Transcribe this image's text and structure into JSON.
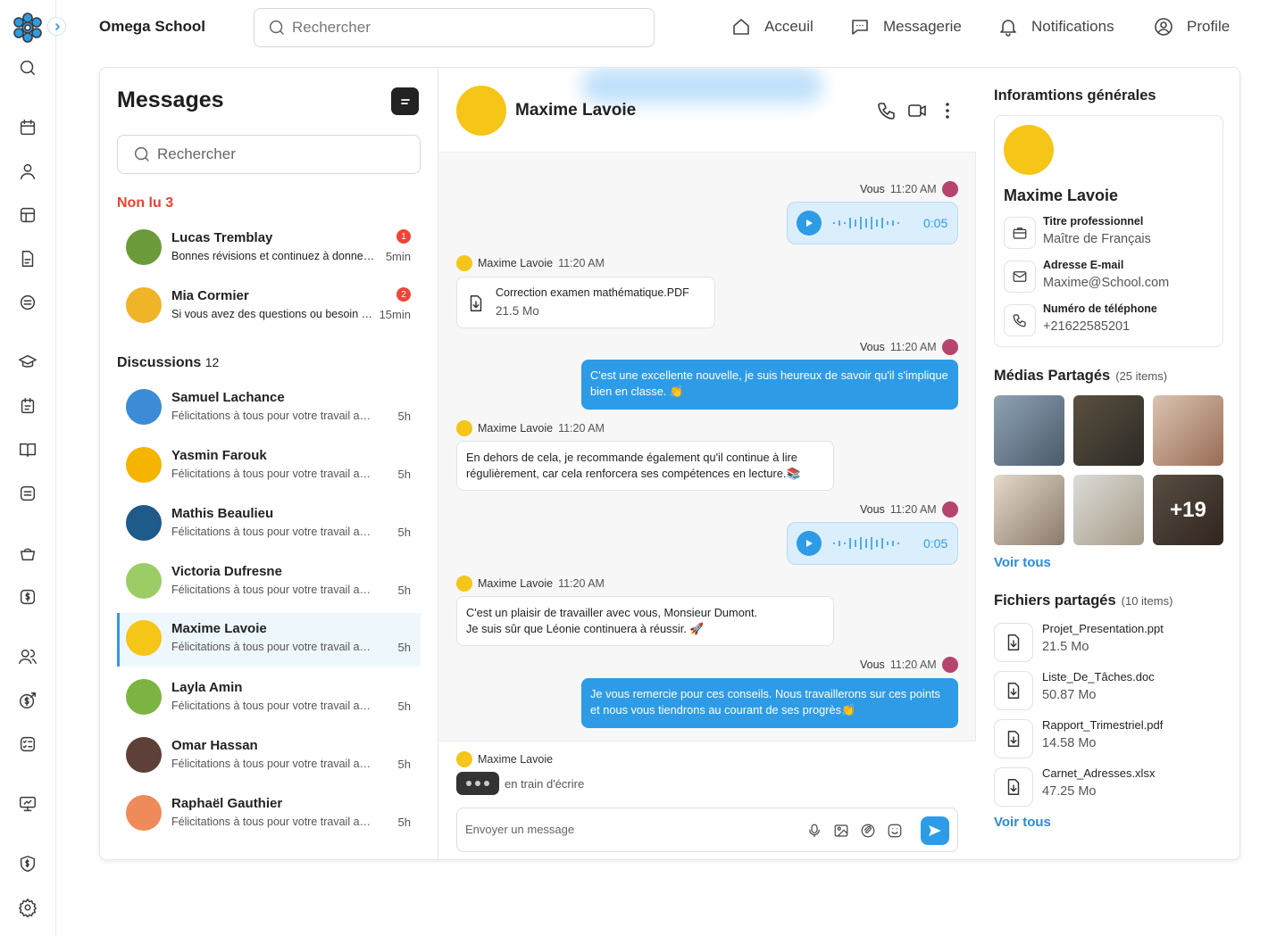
{
  "app": {
    "brand": "Omega School"
  },
  "topbar": {
    "search_placeholder": "Rechercher",
    "nav": [
      {
        "label": "Acceuil",
        "icon": "home-icon"
      },
      {
        "label": "Messagerie",
        "icon": "chat-icon"
      },
      {
        "label": "Notifications",
        "icon": "bell-icon"
      },
      {
        "label": "Profile",
        "icon": "user-icon"
      }
    ]
  },
  "sidebar": {
    "icons": [
      "search-icon",
      "calendar-icon",
      "student-icon",
      "table-icon",
      "document-icon",
      "box-icon",
      "graduation-icon",
      "schedule-icon",
      "book-icon",
      "list-icon",
      "basket-icon",
      "dollar-icon",
      "users-icon",
      "exchange-icon",
      "checklist-icon",
      "presentation-icon",
      "shield-icon",
      "gear-icon"
    ]
  },
  "messages": {
    "title": "Messages",
    "search_placeholder": "Rechercher",
    "unread_label": "Non lu",
    "unread_count": "3",
    "unread": [
      {
        "name": "Lucas Tremblay",
        "preview": "Bonnes révisions et continuez à donner le meilleur",
        "time": "5min",
        "badge": "1",
        "color": "#6b9b3a"
      },
      {
        "name": "Mia Cormier",
        "preview": "Si vous avez des questions ou besoin d'aide",
        "time": "15min",
        "badge": "2",
        "color": "#f0b429"
      }
    ],
    "discussions_label": "Discussions",
    "discussions_count": "12",
    "discussions": [
      {
        "name": "Samuel Lachance",
        "preview": "Félicitations à tous pour votre travail acharné",
        "time": "5h",
        "color": "#3b8bd6"
      },
      {
        "name": "Yasmin Farouk",
        "preview": "Félicitations à tous pour votre travail acharné",
        "time": "5h",
        "color": "#f5b400"
      },
      {
        "name": "Mathis Beaulieu",
        "preview": "Félicitations à tous pour votre travail acharné",
        "time": "5h",
        "color": "#1e5a8a"
      },
      {
        "name": "Victoria Dufresne",
        "preview": "Félicitations à tous pour votre travail acharné",
        "time": "5h",
        "color": "#9ccc65"
      },
      {
        "name": "Maxime Lavoie",
        "preview": "Félicitations à tous pour votre travail acharné",
        "time": "5h",
        "color": "#f5c518"
      },
      {
        "name": "Layla Amin",
        "preview": "Félicitations à tous pour votre travail acharné",
        "time": "5h",
        "color": "#7cb342"
      },
      {
        "name": "Omar Hassan",
        "preview": "Félicitations à tous pour votre travail acharné",
        "time": "5h",
        "color": "#5d4037"
      },
      {
        "name": "Raphaël Gauthier",
        "preview": "Félicitations à tous pour votre travail acharné",
        "time": "5h",
        "color": "#ef8a5a"
      }
    ]
  },
  "chat": {
    "contact": "Maxime Lavoie",
    "you": "Vous",
    "time": "11:20 AM",
    "voice1_duration": "0:05",
    "file_name": "Correction examen mathématique.PDF",
    "file_size": "21.5 Mo",
    "msg_out1": "C'est une excellente nouvelle, je suis heureux de savoir qu'il s'implique bien en classe. 👏",
    "msg_in1": "En dehors de cela, je recommande également qu'il continue à lire régulièrement, car cela renforcera ses compétences en lecture.📚",
    "voice2_duration": "0:05",
    "msg_in2_line1": "C'est un plaisir de travailler avec vous, Monsieur Dumont.",
    "msg_in2_line2": "Je suis sûr que Léonie  continuera à réussir. 🚀",
    "msg_out2": "Je vous remercie pour ces conseils. Nous travaillerons sur ces points et nous vous tiendrons au courant de ses progrès👏",
    "typing_name": "Maxime Lavoie",
    "typing_text": "en train d'écrire",
    "input_placeholder": "Envoyer un message"
  },
  "info": {
    "title": "Inforamtions générales",
    "name": "Maxime Lavoie",
    "rows": [
      {
        "label": "Titre professionnel",
        "value": "Maître de Français",
        "icon": "briefcase-icon"
      },
      {
        "label": "Adresse E-mail",
        "value": "Maxime@School.com",
        "icon": "mail-icon"
      },
      {
        "label": "Numéro de téléphone",
        "value": "+21622585201",
        "icon": "phone-icon"
      }
    ],
    "media_title": "Médias Partagés",
    "media_count": "(25 items)",
    "media_more": "+19",
    "media_link": "Voir tous",
    "files_title": "Fichiers partagés",
    "files_count": "(10 items)",
    "files": [
      {
        "name": "Projet_Presentation.ppt",
        "size": "21.5 Mo"
      },
      {
        "name": "Liste_De_Tâches.doc",
        "size": "50.87 Mo"
      },
      {
        "name": "Rapport_Trimestriel.pdf",
        "size": "14.58 Mo"
      },
      {
        "name": "Carnet_Adresses.xlsx",
        "size": "47.25 Mo"
      }
    ],
    "files_link": "Voir tous"
  },
  "colors": {
    "accent": "#2e9be6",
    "unread": "#e8432d",
    "badge": "#f04438"
  }
}
